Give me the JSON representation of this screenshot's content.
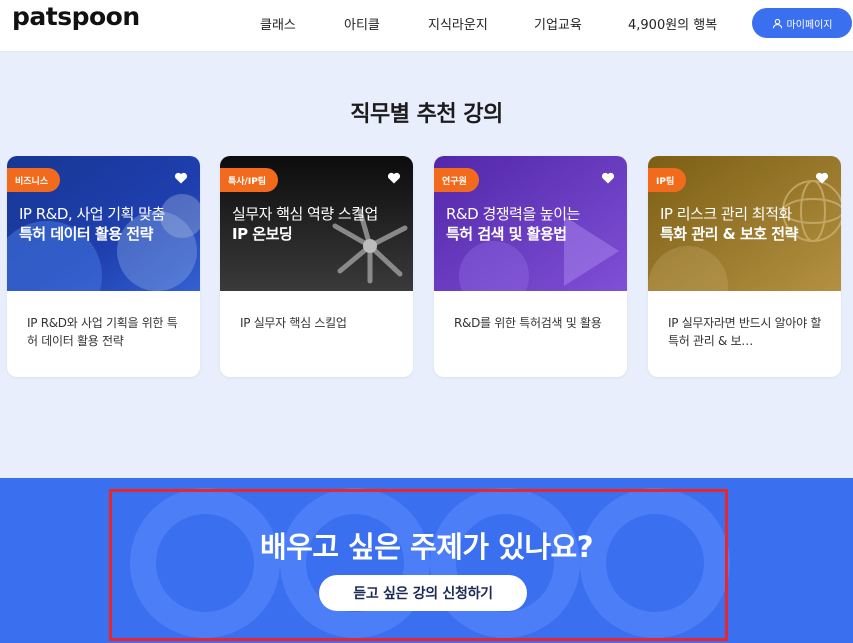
{
  "header": {
    "logo": "patspoon",
    "nav": [
      "클래스",
      "아티클",
      "지식라운지",
      "기업교육",
      "4,900원의 행복"
    ],
    "mypage_label": "마이페이지"
  },
  "section": {
    "title": "직무별 추천 강의"
  },
  "cards": [
    {
      "tag": "비즈니스",
      "line1": "IP R&D, 사업 기획 맞춤",
      "line2": "특허 데이터 활용 전략",
      "desc": "IP R&D와 사업 기획을 위한 특허 데이터 활용 전략"
    },
    {
      "tag": "특사/IP팀",
      "line1": "실무자 핵심 역량 스킬업",
      "line2": "IP 온보딩",
      "desc": "IP 실무자 핵심 스킬업"
    },
    {
      "tag": "연구원",
      "line1": "R&D 경쟁력을 높이는",
      "line2": "특허 검색 및 활용법",
      "desc": "R&D를 위한 특허검색 및 활용"
    },
    {
      "tag": "IP팀",
      "line1": "IP 리스크 관리 최적화",
      "line2": "특화 관리 & 보호 전략",
      "desc": "IP 실무자라면 반드시 알아야 할 특허 관리 & 보…"
    }
  ],
  "banner": {
    "title": "배우고 싶은 주제가 있나요?",
    "button_label": "듣고 싶은 강의 신청하기"
  },
  "colors": {
    "accent": "#3a6ff0",
    "tag": "#f26b1d",
    "highlight_border": "#e8262b",
    "page_bg": "#e9eefc"
  },
  "icons": {
    "heart": "heart-icon",
    "user": "user-icon"
  }
}
